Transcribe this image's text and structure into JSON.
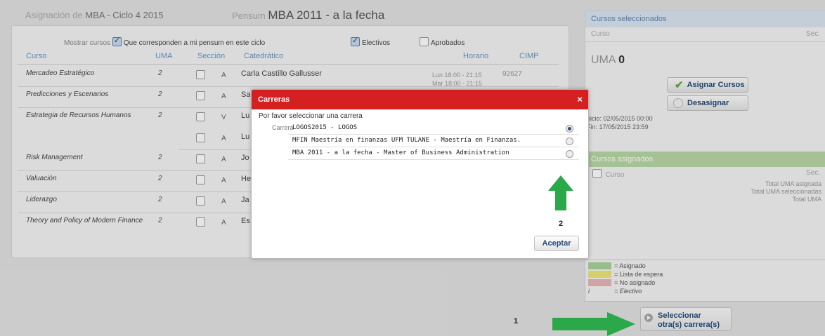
{
  "header": {
    "asignacion_label": "Asignación de",
    "asignacion_value": "MBA - Ciclo 4 2015",
    "pensum_label": "Pensum",
    "pensum_value": "MBA 2011 - a la fecha"
  },
  "filters": {
    "mostrar_label": "Mostrar cursos",
    "mostrar_text": "Que corresponden a mi pensum en este ciclo",
    "electivos": "Electivos",
    "aprobados": "Aprobados"
  },
  "table": {
    "headers": [
      "Curso",
      "UMA",
      "Sección",
      "Catedrático",
      "Horario",
      "CIMP"
    ],
    "rows": [
      {
        "curso": "Mercadeo Estratégico",
        "uma": "2",
        "seccion": "A",
        "catedratico": "Carla Castillo Gallusser",
        "horario1": "Lun 18:00 - 21:15",
        "horario2": "Mar 18:00 - 21:15",
        "cimp": "92627"
      },
      {
        "curso": "Predicciones y Escenarios",
        "uma": "2",
        "seccion": "A",
        "catedratico": "Sa",
        "horario1": "",
        "horario2": "",
        "cimp": ""
      },
      {
        "curso": "Estrategia de Recursos Humanos",
        "uma": "2",
        "seccion": "V",
        "catedratico": "Lu",
        "horario1": "",
        "horario2": "",
        "cimp": ""
      },
      {
        "curso": "",
        "uma": "",
        "seccion": "A",
        "catedratico": "Lu",
        "horario1": "",
        "horario2": "",
        "cimp": ""
      },
      {
        "curso": "Risk Management",
        "uma": "2",
        "seccion": "A",
        "catedratico": "Jo",
        "horario1": "",
        "horario2": "",
        "cimp": ""
      },
      {
        "curso": "Valuación",
        "uma": "2",
        "seccion": "A",
        "catedratico": "He",
        "horario1": "",
        "horario2": "",
        "cimp": ""
      },
      {
        "curso": "Liderazgo",
        "uma": "2",
        "seccion": "A",
        "catedratico": "Ja",
        "horario1": "",
        "horario2": "",
        "cimp": ""
      },
      {
        "curso": "Theory and Policy of Modern Finance",
        "uma": "2",
        "seccion": "A",
        "catedratico": "Es",
        "horario1": "",
        "horario2": "",
        "cimp": ""
      }
    ]
  },
  "selected": {
    "title": "Cursos seleccionados",
    "col_curso": "Curso",
    "col_sec": "Sec.",
    "uma_label": "UMA",
    "uma_value": "0",
    "assign_button": "Asignar Cursos",
    "unassign_button": "Desasignar",
    "inicio": "nicio: 02/05/2015 00:00",
    "fin": "Fin: 17/05/2015 23:59"
  },
  "assigned": {
    "title": "Cursos asignados",
    "col_curso": "Curso",
    "col_sec": "Sec.",
    "total_asignadas": "Total UMA asignada",
    "total_seleccionadas": "Total UMA seleccionadas",
    "total_uma": "Total UMA"
  },
  "legend": {
    "items": [
      {
        "label": "= Asignado",
        "color": "#a9d39a"
      },
      {
        "label": "= Lista de espera",
        "color": "#eee877"
      },
      {
        "label": "= No asignado",
        "color": "#e8b7b7"
      }
    ],
    "electivo_key": "i",
    "electivo_label": "= Electivo"
  },
  "bottom": {
    "marker1": "1",
    "other_button": "Seleccionar otra(s) carrera(s)"
  },
  "modal": {
    "title": "Carreras",
    "close": "×",
    "prompt": "Por favor seleccionar una carrera",
    "carrera_label": "Carrera",
    "options": [
      {
        "label": "LOGOS2015 - LOGOS",
        "selected": true
      },
      {
        "label": "MFIN Maestría en finanzas UFM TULANE - Maestría en Finanzas.",
        "selected": false
      },
      {
        "label": "MBA 2011 - a la fecha - Master of Business Administration",
        "selected": false
      }
    ],
    "marker2": "2",
    "accept_button": "Aceptar"
  },
  "colors": {
    "modal_header": "#d42020",
    "arrow": "#2aa84a",
    "link_blue": "#6a93c7"
  }
}
